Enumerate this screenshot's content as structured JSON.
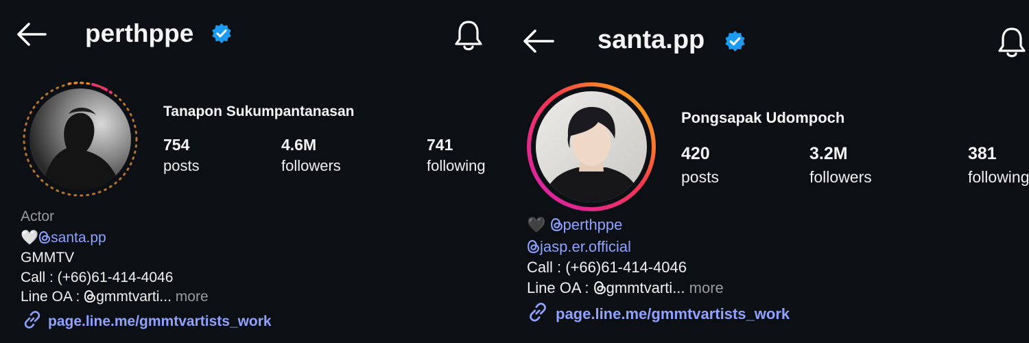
{
  "profiles": [
    {
      "username": "perthppe",
      "full_name": "Tanapon Sukumpantanasan",
      "stats": [
        {
          "value": "754",
          "label": "posts"
        },
        {
          "value": "4.6M",
          "label": "followers"
        },
        {
          "value": "741",
          "label": "following"
        }
      ],
      "bio": {
        "category": "Actor",
        "emoji": "🤍",
        "mention": "santa.pp",
        "lines": [
          "GMMTV",
          "Call : (+66)61-414-4046"
        ],
        "line_oa_prefix": "Line OA : ",
        "line_oa_value": "gmmtvarti",
        "ellipsis": "...",
        "more": "more",
        "link": "page.line.me/gmmtvartists_work"
      },
      "story_ring": "seen"
    },
    {
      "username": "santa.pp",
      "full_name": "Pongsapak Udompoch",
      "stats": [
        {
          "value": "420",
          "label": "posts"
        },
        {
          "value": "3.2M",
          "label": "followers"
        },
        {
          "value": "381",
          "label": "following"
        }
      ],
      "bio": {
        "emoji": "🖤",
        "mention_1": "perthppe",
        "mention_2": "jasp.er.official",
        "call": "Call : (+66)61-414-4046",
        "line_oa_prefix": "Line OA : ",
        "line_oa_value": "gmmtvarti",
        "ellipsis": "...",
        "more": "more",
        "link": "page.line.me/gmmtvartists_work"
      },
      "story_ring": "active"
    }
  ],
  "icons": {
    "back": "back-arrow-icon",
    "verified": "verified-badge-icon",
    "bell": "notification-bell-icon",
    "link": "link-icon",
    "threads": "threads-icon"
  },
  "colors": {
    "background": "#0c0f14",
    "verified": "#1d9bf0",
    "mention": "#8fa3ff",
    "muted": "#9a9ca3"
  }
}
